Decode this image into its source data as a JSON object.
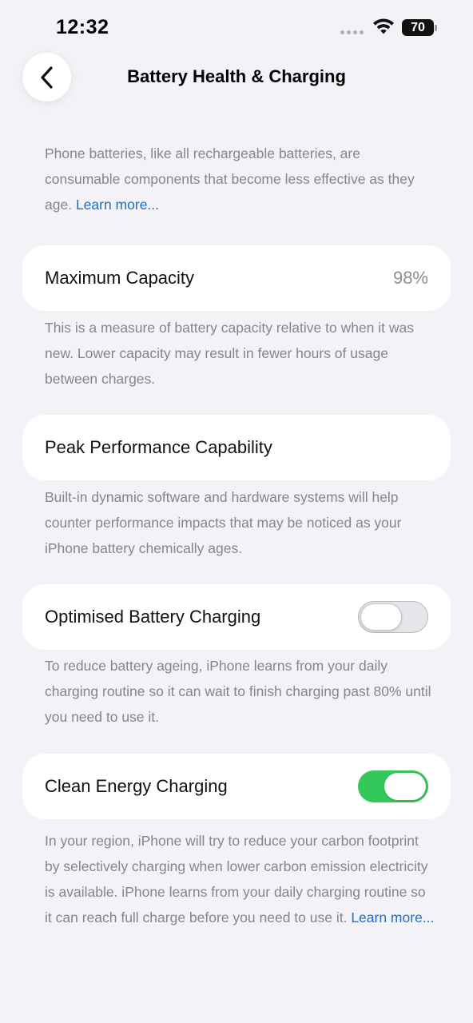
{
  "status_bar": {
    "time": "12:32",
    "battery_level": "70"
  },
  "nav": {
    "title": "Battery Health & Charging"
  },
  "intro": {
    "text": "Phone batteries, like all rechargeable batteries, are consumable components that become less effective as they age.",
    "link": "Learn more..."
  },
  "max_capacity": {
    "label": "Maximum Capacity",
    "value": "98%",
    "note": "This is a measure of battery capacity relative to when it was new. Lower capacity may result in fewer hours of usage between charges."
  },
  "peak_performance": {
    "label": "Peak Performance Capability",
    "note": "Built-in dynamic software and hardware systems will help counter performance impacts that may be noticed as your iPhone battery chemically ages."
  },
  "optimised_charging": {
    "label": "Optimised Battery Charging",
    "enabled": false,
    "note": "To reduce battery ageing, iPhone learns from your daily charging routine so it can wait to finish charging past 80% until you need to use it."
  },
  "clean_energy": {
    "label": "Clean Energy Charging",
    "enabled": true,
    "note": "In your region, iPhone will try to reduce your carbon footprint by selectively charging when lower carbon emission electricity is available. iPhone learns from your daily charging routine so it can reach full charge before you need to use it.",
    "link": "Learn more..."
  },
  "colors": {
    "background": "#f2f2f7",
    "toggle_on": "#34c759",
    "link": "#1e6fc6"
  }
}
